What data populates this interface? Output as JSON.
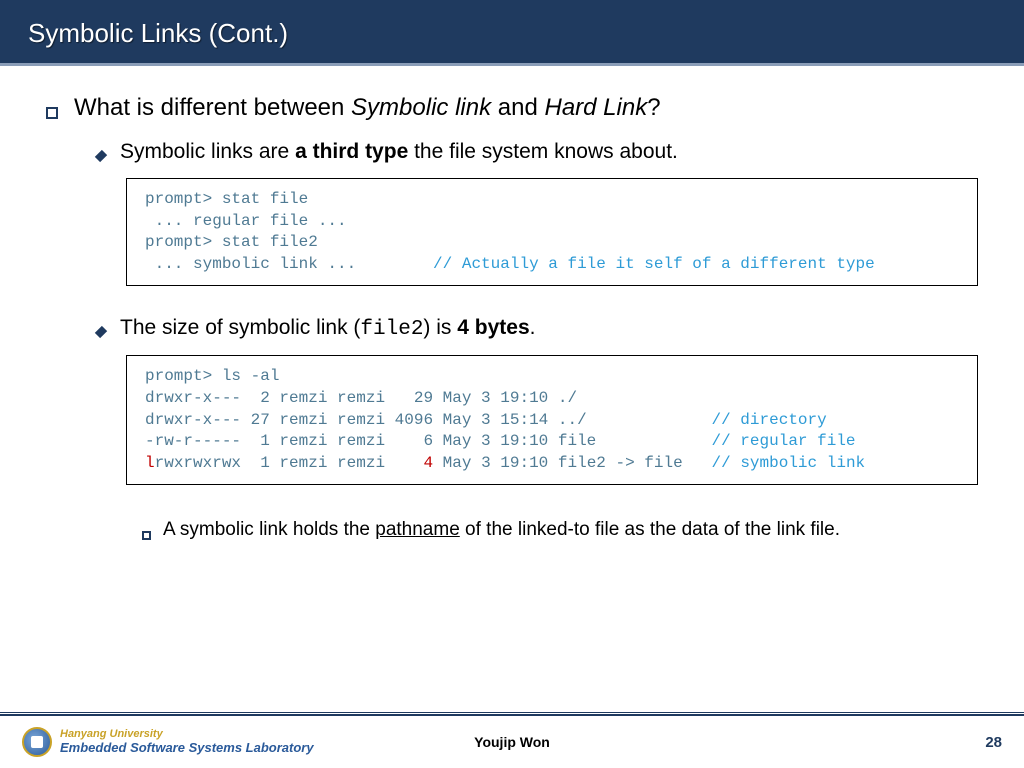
{
  "title": "Symbolic Links (Cont.)",
  "h1": {
    "pre": "What is different between ",
    "em1": "Symbolic link",
    "mid": " and ",
    "em2": "Hard Link",
    "post": "?"
  },
  "b1": {
    "pre": "Symbolic links are ",
    "bold": "a third type",
    "post": " the file system knows about."
  },
  "code1": {
    "l1": "prompt> stat file",
    "l2": " ... regular file ...",
    "l3": "prompt> stat file2",
    "l4a": " ... symbolic link ...        ",
    "l4b": "// Actually a file it self of a different type"
  },
  "b2": {
    "pre": "The size of symbolic link (",
    "mono": "file2",
    "mid": ") is ",
    "bold": "4 bytes",
    "post": "."
  },
  "code2": {
    "l1": "prompt> ls -al",
    "l2": "drwxr-x---  2 remzi remzi   29 May 3 19:10 ./",
    "l3a": "drwxr-x--- 27 remzi remzi 4096 May 3 15:14 ../             ",
    "l3b": "// directory",
    "l4a": "-rw-r-----  1 remzi remzi    6 May 3 19:10 file            ",
    "l4b": "// regular file",
    "l5a": "l",
    "l5b": "rwxrwxrwx  1 remzi remzi    ",
    "l5c": "4",
    "l5d": " May 3 19:10 file2 -> file   ",
    "l5e": "// symbolic link"
  },
  "b3": {
    "pre": "A symbolic link holds the ",
    "ul": "pathname",
    "post": " of the linked-to file as the data of the link file."
  },
  "footer": {
    "uni": "Hanyang University",
    "lab": "Embedded Software Systems Laboratory",
    "author": "Youjip Won",
    "page": "28"
  }
}
